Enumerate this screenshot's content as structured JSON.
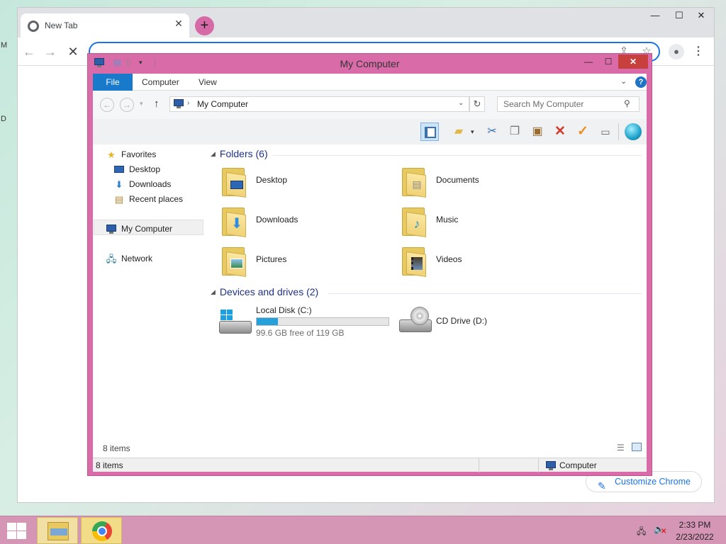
{
  "browser": {
    "tab_title": "New Tab",
    "tab_close": "✕",
    "new_tab": "+",
    "window_min": "—",
    "window_max": "☐",
    "window_close": "✕",
    "back": "←",
    "forward": "→",
    "stop": "✕",
    "customize_label": "Customize Chrome",
    "omnibox_value": "",
    "menu": "⋮"
  },
  "explorer": {
    "title": "My Computer",
    "min": "—",
    "max": "☐",
    "close": "✕",
    "ribbon_tabs": [
      "File",
      "Computer",
      "View"
    ],
    "address": "My Computer",
    "search_placeholder": "Search My Computer",
    "nav": {
      "favorites": "Favorites",
      "desktop": "Desktop",
      "downloads": "Downloads",
      "recent": "Recent places",
      "my_computer": "My Computer",
      "network": "Network"
    },
    "groups": {
      "folders": "Folders (6)",
      "devices": "Devices and drives (2)"
    },
    "folders": [
      "Desktop",
      "Documents",
      "Downloads",
      "Music",
      "Pictures",
      "Videos"
    ],
    "drives": {
      "c_name": "Local Disk (C:)",
      "c_free": "99.6 GB free of 119 GB",
      "c_used_fraction": 0.163,
      "d_name": "CD Drive (D:)"
    },
    "item_count": "8 items",
    "status_count": "8 items",
    "status_location": "Computer"
  },
  "taskbar": {
    "time": "2:33 PM",
    "date": "2/23/2022"
  },
  "colors": {
    "window_frame": "#d96ca8",
    "taskbar": "#d596b6",
    "accent": "#1979ca",
    "close_red": "#c7403d"
  }
}
